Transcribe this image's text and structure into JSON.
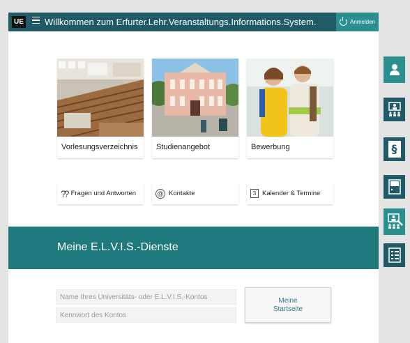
{
  "header": {
    "logo_text": "UE",
    "title": "Willkommen zum Erfurter.Lehr.Veranstaltungs.Informations.System.",
    "login_label": "Anmelden",
    "color": "#1f5a66",
    "accent": "#2b8f90"
  },
  "tiles": [
    {
      "label": "Vorlesungsverzeichnis",
      "image": "lecture-hall-photo"
    },
    {
      "label": "Studienangebot",
      "image": "university-building-photo"
    },
    {
      "label": "Bewerbung",
      "image": "students-photo"
    }
  ],
  "quick_links": [
    {
      "label": "Fragen und Antworten",
      "icon": "question-marks-icon"
    },
    {
      "label": "Kontakte",
      "icon": "at-icon"
    },
    {
      "label": "Kalender & Termine",
      "icon": "calendar-icon"
    }
  ],
  "elvis": {
    "title": "Meine E.L.V.I.S.-Dienste",
    "username_placeholder": "Name Ihres Universitäts- oder E.L.V.I.S.-Kontos",
    "password_placeholder": "Kennwort des Kontos",
    "start_label": "Meine Startseite",
    "band_color": "#1f7a7d"
  },
  "sidebar": [
    {
      "icon": "person-icon",
      "active": true
    },
    {
      "icon": "presentation-audience-icon",
      "active": false
    },
    {
      "icon": "paragraph-icon",
      "active": false
    },
    {
      "icon": "document-icon",
      "active": false
    },
    {
      "icon": "presentation-edit-icon",
      "active": true
    },
    {
      "icon": "list-icon",
      "active": false
    }
  ]
}
